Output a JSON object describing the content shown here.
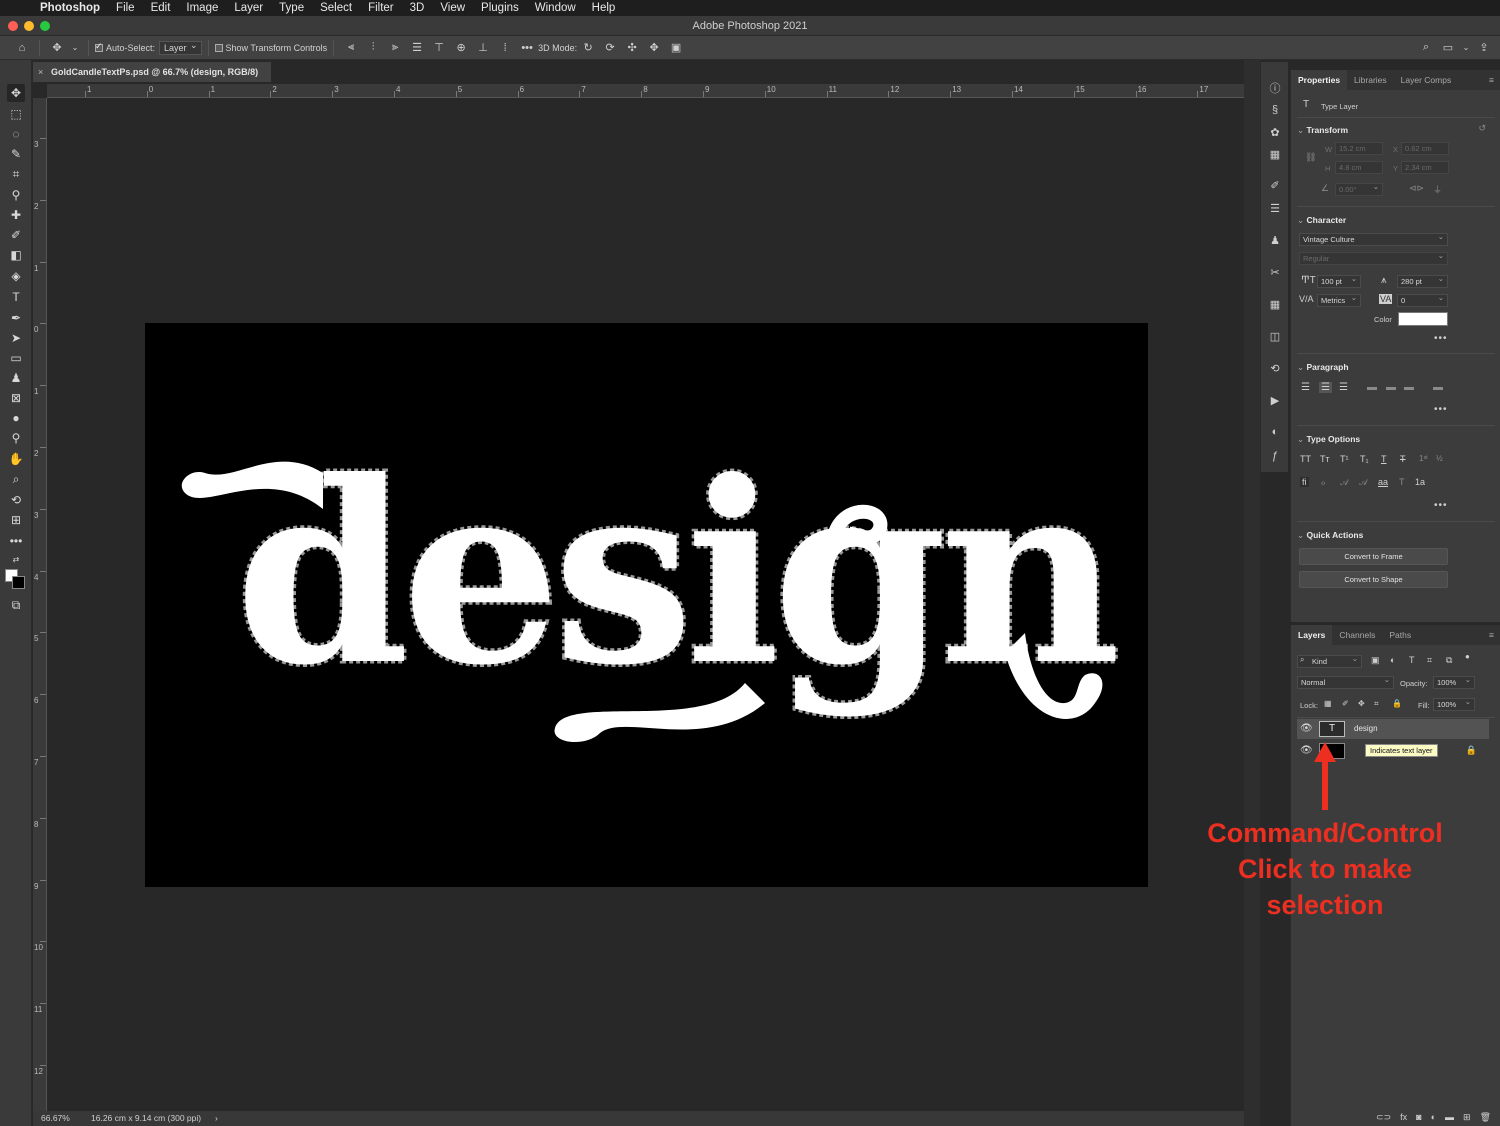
{
  "menubar": {
    "app": "Photoshop",
    "items": [
      "File",
      "Edit",
      "Image",
      "Layer",
      "Type",
      "Select",
      "Filter",
      "3D",
      "View",
      "Plugins",
      "Window",
      "Help"
    ]
  },
  "titlebar": {
    "title": "Adobe Photoshop 2021"
  },
  "options": {
    "auto_select_label": "Auto-Select:",
    "auto_select_value": "Layer",
    "show_transform_label": "Show Transform Controls",
    "mode_3d_label": "3D Mode:"
  },
  "document": {
    "tab_title": "GoldCandleTextPs.psd @ 66.7% (design, RGB/8)",
    "zoom": "66.67%",
    "doc_info": "16.26 cm x 9.14 cm (300 ppi)",
    "art_text": "design",
    "ruler_h": [
      "1",
      "0",
      "1",
      "2",
      "3",
      "4",
      "5",
      "6",
      "7",
      "8",
      "9",
      "10",
      "11",
      "12",
      "13",
      "14",
      "15",
      "16",
      "17"
    ],
    "ruler_v": [
      "3",
      "2",
      "1",
      "0",
      "1",
      "2",
      "3",
      "4",
      "5",
      "6",
      "7",
      "8",
      "9",
      "10",
      "11",
      "12"
    ]
  },
  "properties": {
    "tabs": [
      "Properties",
      "Libraries",
      "Layer Comps"
    ],
    "layer_type": "Type Layer",
    "transform": {
      "title": "Transform",
      "w_label": "W",
      "w": "15.2 cm",
      "x_label": "X",
      "x": "0.62 cm",
      "h_label": "H",
      "h": "4.8 cm",
      "y_label": "Y",
      "y": "2.34 cm",
      "angle": "0.00°"
    },
    "character": {
      "title": "Character",
      "font": "Vintage Culture",
      "style": "Regular",
      "size": "100 pt",
      "leading": "280 pt",
      "kerning": "Metrics",
      "tracking": "0",
      "color_label": "Color",
      "color": "#ffffff"
    },
    "paragraph": {
      "title": "Paragraph"
    },
    "type_options": {
      "title": "Type Options"
    },
    "quick_actions": {
      "title": "Quick Actions",
      "buttons": [
        "Convert to Frame",
        "Convert to Shape"
      ]
    }
  },
  "layers": {
    "tabs": [
      "Layers",
      "Channels",
      "Paths"
    ],
    "filter": "Kind",
    "blend_mode": "Normal",
    "opacity_label": "Opacity:",
    "opacity": "100%",
    "lock_label": "Lock:",
    "fill_label": "Fill:",
    "fill": "100%",
    "items": [
      {
        "name": "design",
        "type": "text",
        "selected": true
      },
      {
        "name": "Background",
        "type": "fill",
        "selected": false,
        "locked": true
      }
    ],
    "tooltip": "Indicates text layer"
  },
  "annotation": {
    "lines": [
      "Command/Control",
      "Click to make",
      "selection"
    ],
    "color": "#ec2f20"
  },
  "icons": {
    "home": "home-icon",
    "move": "move-icon",
    "search": "search-icon",
    "workspace": "workspace-icon",
    "share": "share-icon"
  }
}
